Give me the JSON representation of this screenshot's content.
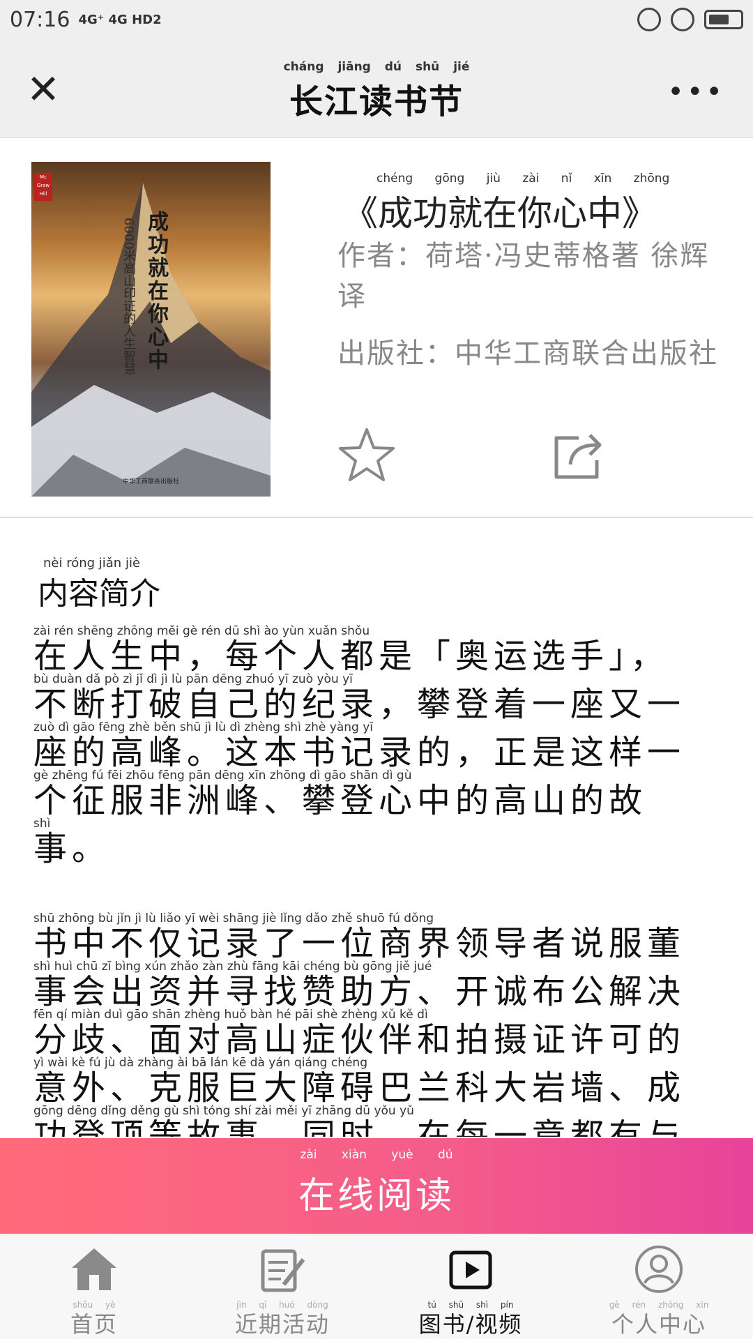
{
  "status_bar": {
    "time": "07:16",
    "network": "4G⁺ 4G HD2"
  },
  "nav": {
    "title": "长江读书节",
    "title_pinyin": "cháng jiāng dú shū jié"
  },
  "book": {
    "title": "《成功就在你心中》",
    "title_pinyin": "chéng gōng jiù zài nǐ xīn zhōng",
    "author_line": "作者：荷塔·冯史蒂格著 徐辉译",
    "publisher_line": "出版社：中华工商联合出版社",
    "cover_title": "成功就在你心中",
    "cover_subtitle": "6000米高山印证的人生智慧",
    "cover_publisher": "中华工商联合出版社"
  },
  "content": {
    "section_title": "内容简介",
    "section_title_pinyin": "nèi róng jiǎn jiè",
    "para1_lines": [
      "在人生中，每个人都是「奥运选手」，",
      "不断打破自己的纪录，攀登着一座又一",
      "座的高峰。这本书记录的，正是这样一",
      "个征服非洲峰、攀登心中的高山的故",
      "事。"
    ],
    "para1_pinyin": [
      "zài  rén  shēng zhōng          měi   gè   rén   dū   shì          ào  yùn xuǎn shǒu",
      "bù  duàn  dǎ   pò   zì   jǐ   dì   jì   lù         pān dēng zhuó  yī  zuò  yòu  yī",
      "zuò  dì  gāo fēng          zhè  běn  shū  jì   lù   dì        zhèng shì  zhè yàng  yī",
      "gè zhēng  fú   fēi zhōu fēng        pān dēng  xīn zhōng  dì  gāo shān  dì   gù",
      "shì"
    ],
    "para2_lines": [
      "书中不仅记录了一位商界领导者说服董",
      "事会出资并寻找赞助方、开诚布公解决",
      "分歧、面对高山症伙伴和拍摄证许可的",
      "意外、克服巨大障碍巴兰科大岩墙、成",
      "功登顶等故事。同时，在每一章都有与"
    ],
    "para2_pinyin": [
      "shū zhōng  bù   jǐn   jì   lù  liǎo  yī  wèi shāng jiè  lǐng dǎo  zhě  shuō  fú  dǒng",
      "shì  huì  chū   zī  bìng  xún zhǎo zàn  zhù fāng        kāi chéng  bù  gōng  jiě  jué",
      "fēn   qí        miàn duì  gāo shān zhèng huǒ bàn  hé   pāi  shè zhèng  xǔ   kě   dì",
      "yì  wài        kè   fú   jù   dà zhàng  ài   bā   lán  kē   dà  yán qiáng       chéng",
      "gōng dēng dǐng děng gù  shì        tóng shí        zài  měi   yī zhāng dū  yǒu  yǔ"
    ]
  },
  "read_button": {
    "label": "在线阅读",
    "pinyin": "zài xiàn yuè dú"
  },
  "tabs": [
    {
      "label": "首页",
      "pinyin": "shǒu yè",
      "icon": "home-icon",
      "active": false
    },
    {
      "label": "近期活动",
      "pinyin": "jìn qī huó dòng",
      "icon": "activity-icon",
      "active": false
    },
    {
      "label": "图书/视频",
      "pinyin": "tú shū shì pín",
      "icon": "video-icon",
      "active": true
    },
    {
      "label": "个人中心",
      "pinyin": "gè rén zhōng xīn",
      "icon": "user-icon",
      "active": false
    }
  ],
  "colors": {
    "accent_start": "#ff6b7a",
    "accent_end": "#e8439a"
  }
}
